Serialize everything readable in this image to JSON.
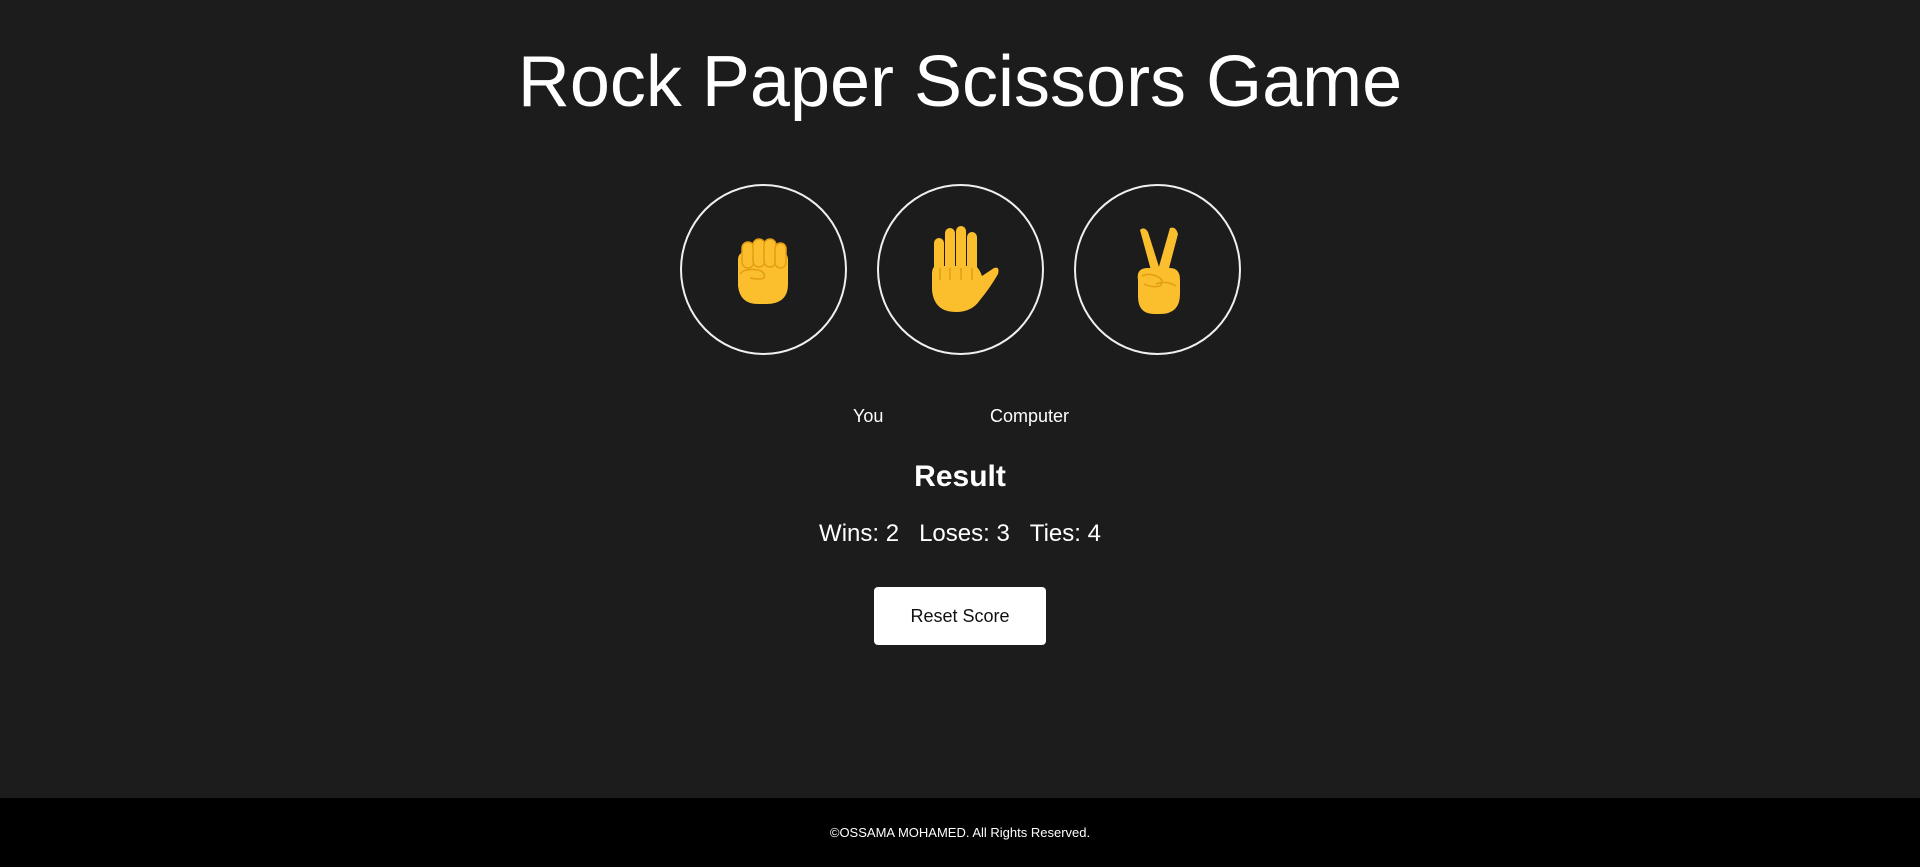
{
  "title": "Rock Paper Scissors Game",
  "choices": [
    {
      "name": "rock",
      "icon": "raised-fist-icon"
    },
    {
      "name": "paper",
      "icon": "raised-hand-icon"
    },
    {
      "name": "scissors",
      "icon": "victory-hand-icon"
    }
  ],
  "players": {
    "you_label": "You",
    "computer_label": "Computer"
  },
  "result": {
    "heading": "Result"
  },
  "score": {
    "wins": "Wins: 2",
    "loses": "Loses: 3",
    "ties": "Ties: 4"
  },
  "reset_label": "Reset Score",
  "footer_text": "©OSSAMA MOHAMED. All Rights Reserved.",
  "colors": {
    "background": "#1d1c1d",
    "footer_background": "#000000",
    "emoji_yellow": "#fbbf2d",
    "emoji_shade": "#e39d12",
    "button_background": "#ffffff"
  }
}
